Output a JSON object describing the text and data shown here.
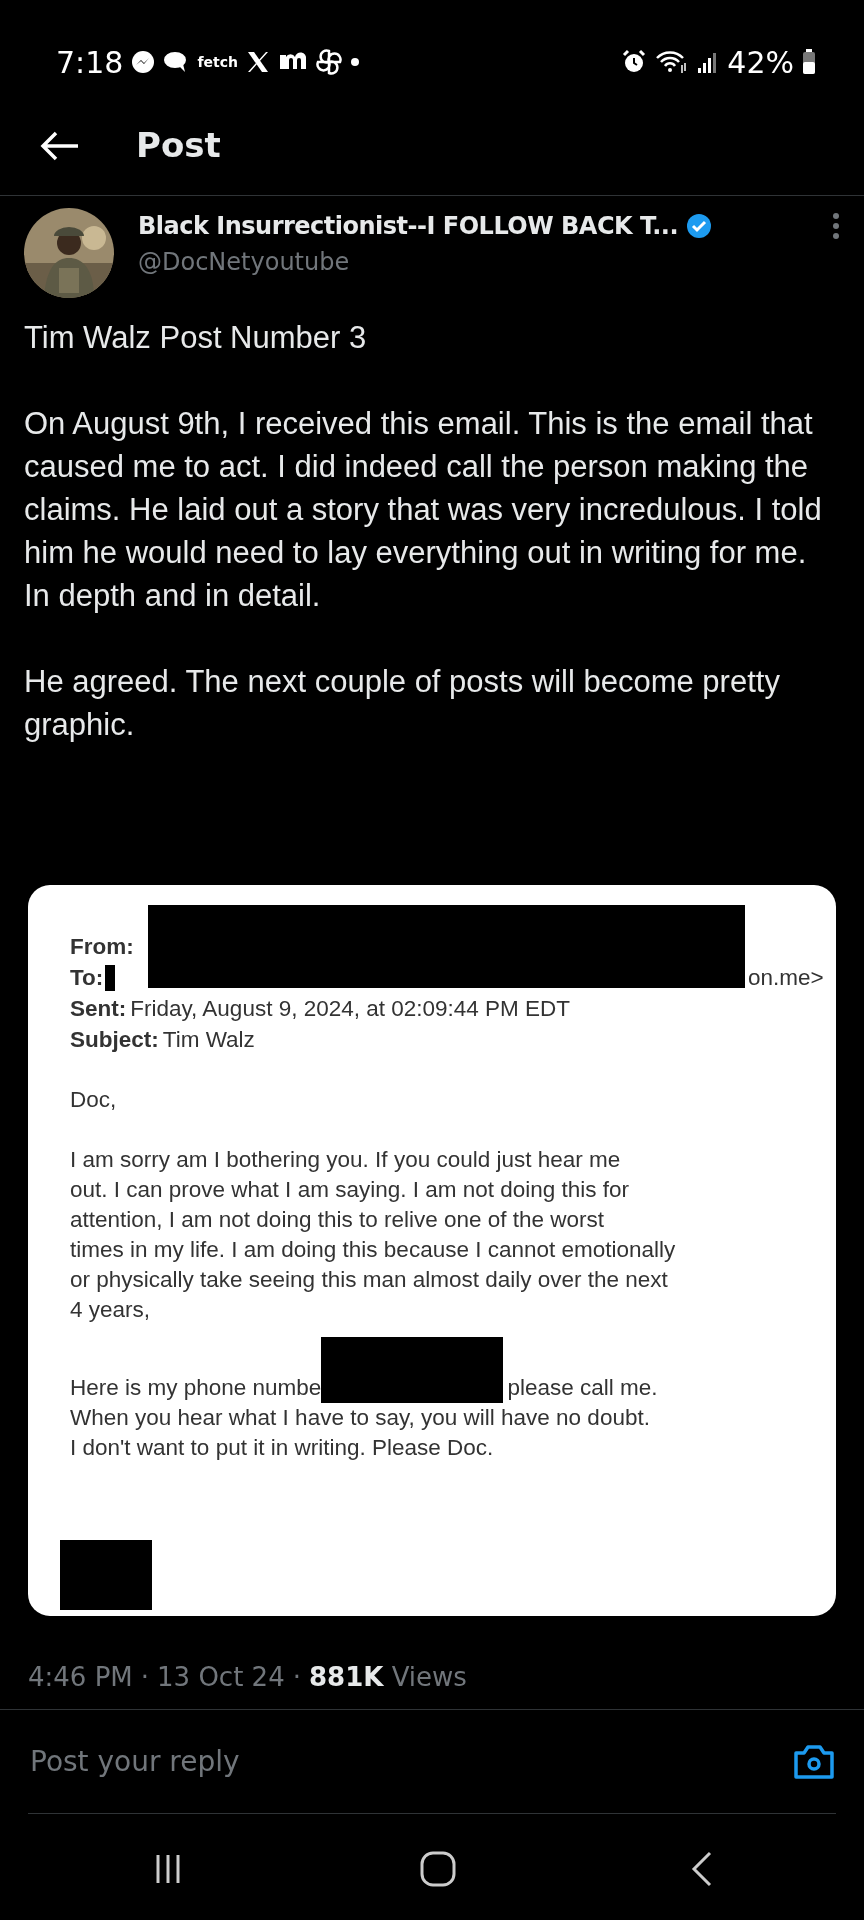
{
  "status_bar": {
    "time": "7:18",
    "app_label": "fetch",
    "battery": "42%"
  },
  "header": {
    "title": "Post"
  },
  "author": {
    "name": "Black Insurrectionist--I FOLLOW BACK T...",
    "handle": "@DocNetyoutube",
    "verified": true
  },
  "post": {
    "paragraphs": [
      "Tim Walz Post Number 3",
      "On August 9th, I received this email. This is the email that caused me to act. I did indeed call the person making the claims. He laid out a story that was very incredulous. I told him he would need to lay everything out in writing for me. In depth and in detail.",
      "He agreed. The next couple of posts will become pretty graphic."
    ]
  },
  "email": {
    "fields": [
      {
        "label": "From:",
        "redacted": true
      },
      {
        "label": "To:",
        "value": "on.me>",
        "redacted": true
      },
      {
        "label": "Sent:",
        "value": "Friday, August 9, 2024, at 02:09:44 PM EDT",
        "redacted": false
      },
      {
        "label": "Subject:",
        "value": "Tim Walz",
        "redacted": false
      }
    ],
    "greeting": "Doc,",
    "body_lines": [
      "I am sorry am I bothering you. If you could just hear me",
      "out. I can prove what I am saying. I am not doing this for",
      "attention, I am not doing this to relive one of the worst",
      "times in my life. I am doing this because I cannot emotionally",
      "or physically take seeing this man almost daily over the next",
      "4 years,"
    ],
    "phone_before": "Here is my phone numbe",
    "phone_after": "please call me.",
    "closing_lines": [
      "When you hear what I have to say, you will have no doubt.",
      "I don't want to put it in writing. Please Doc."
    ]
  },
  "meta": {
    "time": "4:46 PM",
    "separator_1": "·",
    "date": "13 Oct 24",
    "separator_2": "·",
    "views_count": "881K",
    "views_label": "Views"
  },
  "reply": {
    "placeholder": "Post your reply"
  }
}
